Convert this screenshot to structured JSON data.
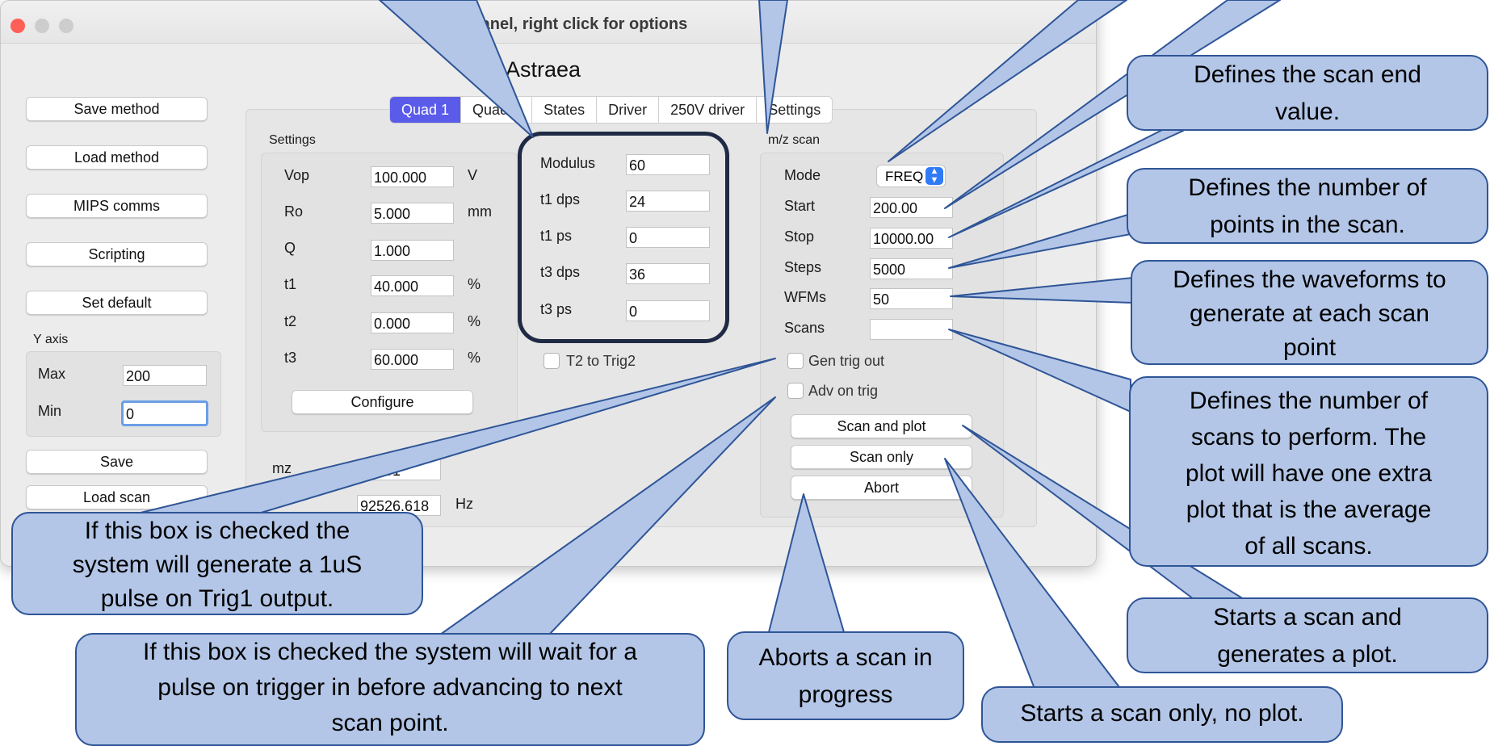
{
  "window": {
    "title": "Control panel, right click for options",
    "app_name": "Astraea"
  },
  "left_buttons": [
    "Save method",
    "Load method",
    "MIPS comms",
    "Scripting",
    "Set default"
  ],
  "y_axis": {
    "label": "Y axis",
    "max_label": "Max",
    "max_value": "200",
    "min_label": "Min",
    "min_value": "0"
  },
  "bottom_buttons": {
    "save": "Save",
    "load_scan": "Load scan"
  },
  "tabs": [
    "Quad 1",
    "Quad 2",
    "States",
    "Driver",
    "250V driver",
    "Settings"
  ],
  "settings": {
    "header": "Settings",
    "rows": [
      {
        "label": "Vop",
        "value": "100.000",
        "unit": "V"
      },
      {
        "label": "Ro",
        "value": "5.000",
        "unit": "mm"
      },
      {
        "label": "Q",
        "value": "1.000",
        "unit": ""
      },
      {
        "label": "t1",
        "value": "40.000",
        "unit": "%"
      },
      {
        "label": "t2",
        "value": "0.000",
        "unit": "%"
      },
      {
        "label": "t3",
        "value": "60.000",
        "unit": "%"
      }
    ],
    "configure_button": "Configure"
  },
  "readouts": {
    "mz_label": "mz",
    "mz_value": "10001",
    "freq_label": "F",
    "freq_value": "92526.618",
    "freq_unit": "Hz"
  },
  "modulus": {
    "rows": [
      {
        "label": "Modulus",
        "value": "60"
      },
      {
        "label": "t1 dps",
        "value": "24"
      },
      {
        "label": "t1 ps",
        "value": "0"
      },
      {
        "label": "t3 dps",
        "value": "36"
      },
      {
        "label": "t3 ps",
        "value": "0"
      }
    ],
    "t2_trig_label": "T2 to Trig2"
  },
  "mz_scan": {
    "header": "m/z scan",
    "mode_label": "Mode",
    "mode_value": "FREQ",
    "rows": [
      {
        "label": "Start",
        "value": "200.00"
      },
      {
        "label": "Stop",
        "value": "10000.00"
      },
      {
        "label": "Steps",
        "value": "5000"
      },
      {
        "label": "WFMs",
        "value": "50"
      },
      {
        "label": "Scans",
        "value": ""
      }
    ],
    "gen_trig_label": "Gen trig out",
    "adv_trig_label": "Adv on trig",
    "scan_plot_button": "Scan and plot",
    "scan_only_button": "Scan only",
    "abort_button": "Abort"
  },
  "callouts": {
    "end_value": [
      "Defines the scan end",
      "value."
    ],
    "points": [
      "Defines the number of",
      "points in the scan."
    ],
    "waveforms": [
      "Defines the waveforms to",
      "generate at each scan",
      "point"
    ],
    "scans": [
      "Defines the number of",
      "scans to perform. The",
      "plot will have one extra",
      "plot that is the average",
      "of all scans."
    ],
    "scan_plot": [
      "Starts a scan and",
      "generates a plot."
    ],
    "scan_only": [
      "Starts a scan only, no plot."
    ],
    "abort": [
      "Aborts a scan in",
      "progress"
    ],
    "gen_trig": [
      "If this box is checked the",
      "system will generate a 1uS",
      "pulse on Trig1 output."
    ],
    "adv_trig": [
      "If this box is checked the system will wait for a",
      "pulse on trigger in before advancing to next",
      "scan point."
    ]
  },
  "colors": {
    "callout_fill": "#b3c6e7",
    "callout_border": "#2f5597",
    "tab_active": "#5b5bea",
    "highlight_frame": "#1f2a44"
  }
}
